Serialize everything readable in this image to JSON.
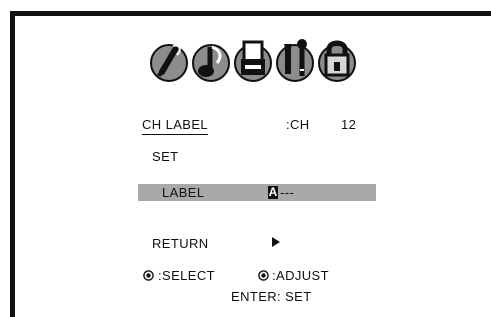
{
  "menu_icons": [
    {
      "name": "picture-icon"
    },
    {
      "name": "audio-icon"
    },
    {
      "name": "setup-icon"
    },
    {
      "name": "tools-icon"
    },
    {
      "name": "lock-icon"
    }
  ],
  "screen": {
    "title": "CH LABEL",
    "channel_prefix": ":CH",
    "channel_number": "12",
    "set_label": "SET",
    "label_item": "LABEL",
    "label_value_first": "A",
    "label_value_rest": "---",
    "return_label": "RETURN",
    "select_hint": ":SELECT",
    "adjust_hint": ":ADJUST",
    "enter_hint": "ENTER: SET"
  },
  "colors": {
    "highlight": "#a9a9a9",
    "frame": "#111111"
  }
}
